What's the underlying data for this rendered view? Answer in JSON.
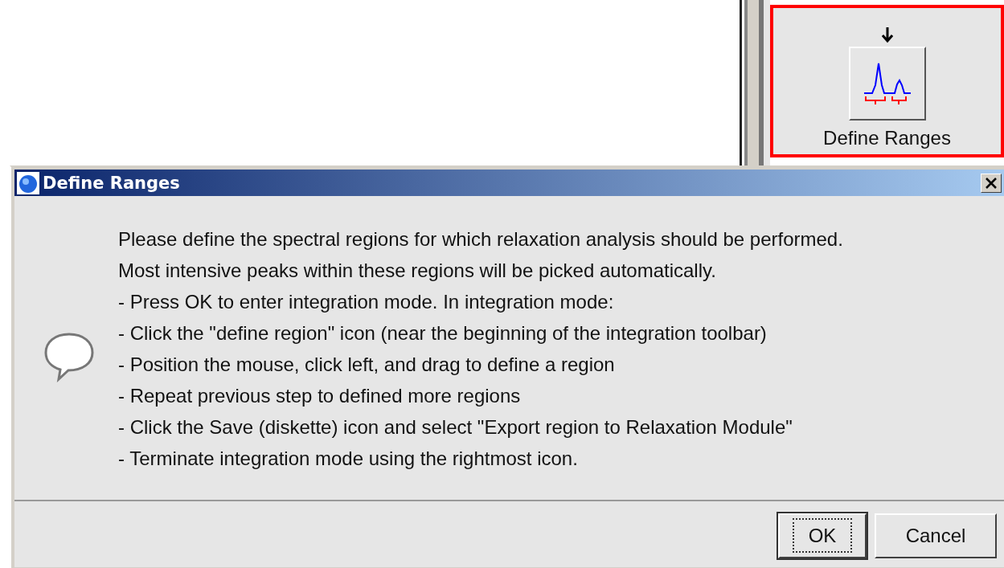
{
  "toolbar_button": {
    "label": "Define Ranges",
    "highlighted": true
  },
  "dialog": {
    "title": "Define Ranges",
    "message_lines": [
      "Please define the spectral regions for which relaxation analysis should be performed.",
      "Most intensive peaks within these regions will be picked automatically.",
      "- Press OK to enter integration mode. In integration mode:",
      "- Click the \"define region\" icon (near the beginning of the integration toolbar)",
      "- Position the mouse, click left, and drag to define a region",
      "- Repeat previous step to defined more regions",
      "- Click the Save (diskette) icon and select \"Export region to Relaxation Module\"",
      "- Terminate integration mode using the rightmost icon."
    ],
    "buttons": [
      {
        "label": "OK",
        "focused": true
      },
      {
        "label": "Cancel",
        "focused": false
      }
    ]
  }
}
